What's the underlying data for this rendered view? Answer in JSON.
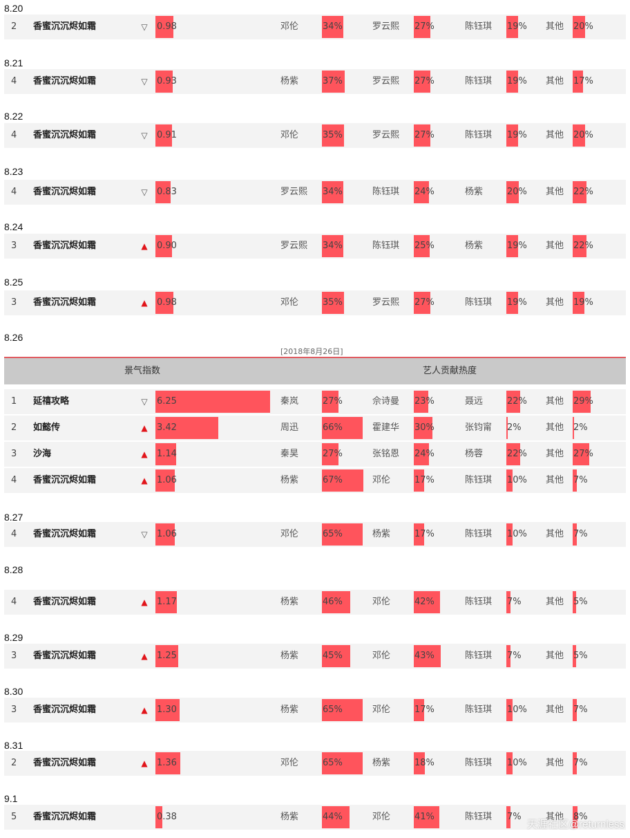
{
  "chart_data": {
    "type": "table",
    "big_table_date": "[2018年8月26日]",
    "header": {
      "index_label": "景气指数",
      "artists_label": "艺人贡献热度"
    },
    "watermark": "天涯社区@returnless",
    "groups": [
      {
        "date": "8.20",
        "rows": [
          {
            "rank": "2",
            "name": "香蜜沉沉烬如霜",
            "trend": "down",
            "index": "0.98",
            "a": [
              {
                "n": "邓伦",
                "p": "34%"
              },
              {
                "n": "罗云熙",
                "p": "27%"
              },
              {
                "n": "陈钰琪",
                "p": "19%"
              },
              {
                "n": "其他",
                "p": "20%"
              }
            ]
          }
        ]
      },
      {
        "date": "8.21",
        "rows": [
          {
            "rank": "4",
            "name": "香蜜沉沉烬如霜",
            "trend": "down",
            "index": "0.93",
            "a": [
              {
                "n": "杨紫",
                "p": "37%"
              },
              {
                "n": "罗云熙",
                "p": "27%"
              },
              {
                "n": "陈钰琪",
                "p": "19%"
              },
              {
                "n": "其他",
                "p": "17%"
              }
            ]
          }
        ]
      },
      {
        "date": "8.22",
        "rows": [
          {
            "rank": "4",
            "name": "香蜜沉沉烬如霜",
            "trend": "down",
            "index": "0.91",
            "a": [
              {
                "n": "邓伦",
                "p": "35%"
              },
              {
                "n": "罗云熙",
                "p": "27%"
              },
              {
                "n": "陈钰琪",
                "p": "19%"
              },
              {
                "n": "其他",
                "p": "20%"
              }
            ]
          }
        ]
      },
      {
        "date": "8.23",
        "rows": [
          {
            "rank": "4",
            "name": "香蜜沉沉烬如霜",
            "trend": "down",
            "index": "0.83",
            "a": [
              {
                "n": "罗云熙",
                "p": "34%"
              },
              {
                "n": "陈钰琪",
                "p": "24%"
              },
              {
                "n": "杨紫",
                "p": "20%"
              },
              {
                "n": "其他",
                "p": "22%"
              }
            ]
          }
        ]
      },
      {
        "date": "8.24",
        "rows": [
          {
            "rank": "3",
            "name": "香蜜沉沉烬如霜",
            "trend": "up",
            "index": "0.90",
            "a": [
              {
                "n": "罗云熙",
                "p": "34%"
              },
              {
                "n": "陈钰琪",
                "p": "25%"
              },
              {
                "n": "杨紫",
                "p": "19%"
              },
              {
                "n": "其他",
                "p": "22%"
              }
            ]
          }
        ]
      },
      {
        "date": "8.25",
        "rows": [
          {
            "rank": "3",
            "name": "香蜜沉沉烬如霜",
            "trend": "up",
            "index": "0.98",
            "a": [
              {
                "n": "邓伦",
                "p": "35%"
              },
              {
                "n": "罗云熙",
                "p": "27%"
              },
              {
                "n": "陈钰琪",
                "p": "19%"
              },
              {
                "n": "其他",
                "p": "19%"
              }
            ]
          }
        ]
      },
      {
        "date": "8.26",
        "rows": [
          {
            "rank": "1",
            "name": "延禧攻略",
            "trend": "down",
            "index": "6.25",
            "a": [
              {
                "n": "秦岚",
                "p": "27%"
              },
              {
                "n": "佘诗曼",
                "p": "23%"
              },
              {
                "n": "聂远",
                "p": "22%"
              },
              {
                "n": "其他",
                "p": "29%"
              }
            ]
          },
          {
            "rank": "2",
            "name": "如懿传",
            "trend": "up",
            "index": "3.42",
            "a": [
              {
                "n": "周迅",
                "p": "66%"
              },
              {
                "n": "霍建华",
                "p": "30%"
              },
              {
                "n": "张钧甯",
                "p": "2%"
              },
              {
                "n": "其他",
                "p": "2%"
              }
            ]
          },
          {
            "rank": "3",
            "name": "沙海",
            "trend": "up",
            "index": "1.14",
            "a": [
              {
                "n": "秦昊",
                "p": "27%"
              },
              {
                "n": "张铭恩",
                "p": "24%"
              },
              {
                "n": "杨蓉",
                "p": "22%"
              },
              {
                "n": "其他",
                "p": "27%"
              }
            ]
          },
          {
            "rank": "4",
            "name": "香蜜沉沉烬如霜",
            "trend": "up",
            "index": "1.06",
            "a": [
              {
                "n": "杨紫",
                "p": "67%"
              },
              {
                "n": "邓伦",
                "p": "17%"
              },
              {
                "n": "陈钰琪",
                "p": "10%"
              },
              {
                "n": "其他",
                "p": "7%"
              }
            ]
          }
        ]
      },
      {
        "date": "8.27",
        "rows": [
          {
            "rank": "4",
            "name": "香蜜沉沉烬如霜",
            "trend": "down",
            "index": "1.06",
            "a": [
              {
                "n": "邓伦",
                "p": "65%"
              },
              {
                "n": "杨紫",
                "p": "17%"
              },
              {
                "n": "陈钰琪",
                "p": "10%"
              },
              {
                "n": "其他",
                "p": "7%"
              }
            ]
          }
        ]
      },
      {
        "date": "8.28",
        "rows": [
          {
            "rank": "4",
            "name": "香蜜沉沉烬如霜",
            "trend": "up",
            "index": "1.17",
            "a": [
              {
                "n": "杨紫",
                "p": "46%"
              },
              {
                "n": "邓伦",
                "p": "42%"
              },
              {
                "n": "陈钰琪",
                "p": "7%"
              },
              {
                "n": "其他",
                "p": "5%"
              }
            ]
          }
        ]
      },
      {
        "date": "8.29",
        "rows": [
          {
            "rank": "3",
            "name": "香蜜沉沉烬如霜",
            "trend": "up",
            "index": "1.25",
            "a": [
              {
                "n": "杨紫",
                "p": "45%"
              },
              {
                "n": "邓伦",
                "p": "43%"
              },
              {
                "n": "陈钰琪",
                "p": "7%"
              },
              {
                "n": "其他",
                "p": "5%"
              }
            ]
          }
        ]
      },
      {
        "date": "8.30",
        "rows": [
          {
            "rank": "3",
            "name": "香蜜沉沉烬如霜",
            "trend": "up",
            "index": "1.30",
            "a": [
              {
                "n": "杨紫",
                "p": "65%"
              },
              {
                "n": "邓伦",
                "p": "17%"
              },
              {
                "n": "陈钰琪",
                "p": "10%"
              },
              {
                "n": "其他",
                "p": "7%"
              }
            ]
          }
        ]
      },
      {
        "date": "8.31",
        "rows": [
          {
            "rank": "2",
            "name": "香蜜沉沉烬如霜",
            "trend": "up",
            "index": "1.36",
            "a": [
              {
                "n": "邓伦",
                "p": "65%"
              },
              {
                "n": "杨紫",
                "p": "18%"
              },
              {
                "n": "陈钰琪",
                "p": "10%"
              },
              {
                "n": "其他",
                "p": "7%"
              }
            ]
          }
        ]
      },
      {
        "date": "9.1",
        "rows": [
          {
            "rank": "5",
            "name": "香蜜沉沉烬如霜",
            "trend": "none",
            "index": "0.38",
            "a": [
              {
                "n": "杨紫",
                "p": "44%"
              },
              {
                "n": "邓伦",
                "p": "41%"
              },
              {
                "n": "陈钰琪",
                "p": "7%"
              },
              {
                "n": "其他",
                "p": "8%"
              }
            ]
          }
        ]
      }
    ]
  }
}
